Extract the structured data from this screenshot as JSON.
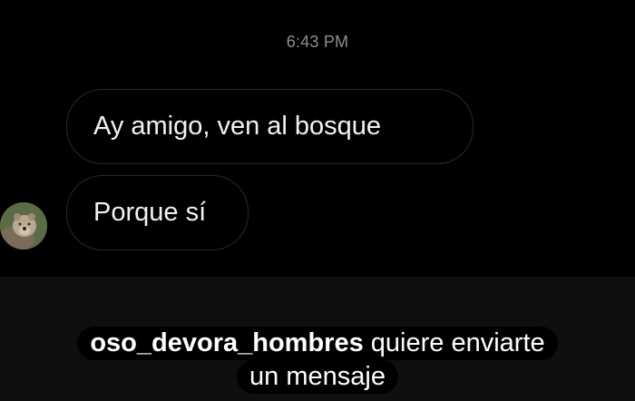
{
  "conversation": {
    "timestamp": "6:43 PM",
    "messages": [
      {
        "text": "Ay amigo, ven al bosque"
      },
      {
        "text": "Porque sí"
      }
    ],
    "sender_avatar_icon": "bear-avatar"
  },
  "message_request": {
    "username": "oso_devora_hombres",
    "text_after_username": "quiere enviarte",
    "text_line_2": "un mensaje"
  }
}
